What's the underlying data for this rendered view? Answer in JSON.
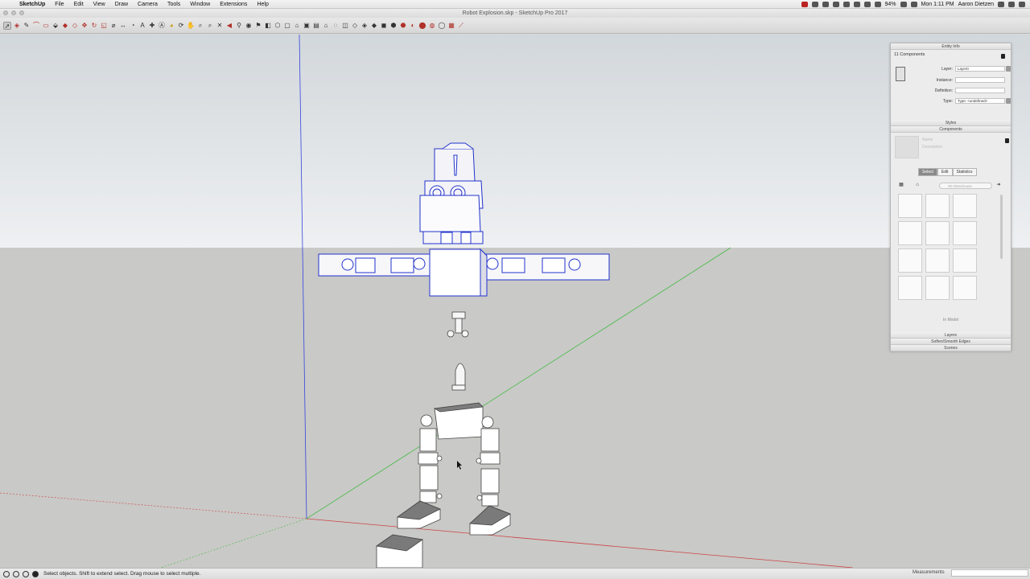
{
  "menubar": {
    "app": "SketchUp",
    "items": [
      "File",
      "Edit",
      "View",
      "Draw",
      "Camera",
      "Tools",
      "Window",
      "Extensions",
      "Help"
    ],
    "battery": "94%",
    "clock": "Mon 1:11 PM",
    "user": "Aaron Dietzen"
  },
  "window": {
    "title": "Robot Explosion.skp - SketchUp Pro 2017"
  },
  "entity_info": {
    "title": "Entity Info",
    "selection": "11 Components",
    "layer_label": "Layer:",
    "layer_value": "Layer0",
    "instance_label": "Instance:",
    "definition_label": "Definition:",
    "type_label": "Type:",
    "type_value": "Type: <undefined>"
  },
  "trays": {
    "styles": "Styles",
    "components": "Components",
    "layers": "Layers",
    "soften": "Soften/Smooth Edges",
    "scenes": "Scenes"
  },
  "components": {
    "name_placeholder": "Name",
    "description_placeholder": "Description",
    "tabs": [
      "Select",
      "Edit",
      "Statistics"
    ],
    "active_tab": "Select",
    "search_placeholder": "3D Warehouse",
    "footer": "In Model"
  },
  "status": {
    "hint": "Select objects. Shift to extend select. Drag mouse to select multiple.",
    "measurements_label": "Measurements"
  },
  "colors": {
    "axis_blue": "#3344dd",
    "axis_red": "#cc4444",
    "axis_green": "#44bb44",
    "selection": "#2233cc"
  }
}
